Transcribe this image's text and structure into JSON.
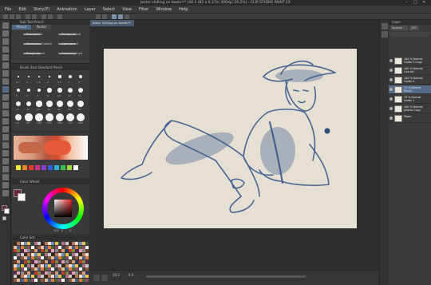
{
  "window": {
    "title": "Jester chilling on boots!!* (44.1 (85 x 6.27in 300dpi 29.2%) - CLIP STUDIO PAINT EX"
  },
  "menu": [
    "File",
    "Edit",
    "Story(P)",
    "Animation",
    "Layer",
    "Select",
    "View",
    "Filter",
    "Window",
    "Help"
  ],
  "subtool": {
    "panel_title": "Sub Tool Pencil",
    "tabs": [
      "Pencil",
      "Pastel"
    ],
    "brushes": [
      {
        "label": "Real pencil"
      },
      {
        "label": "Design pencil"
      },
      {
        "label": "Mechanical pencil"
      },
      {
        "label": "Light pencil"
      },
      {
        "label": "Rough pencil"
      },
      {
        "label": "Colored pencil"
      }
    ]
  },
  "brush_size": {
    "panel_title": "Brush Size Standard Pencil",
    "labels": [
      "0.7",
      "1",
      "1.5",
      "2",
      "2.5",
      "3",
      "4",
      "5",
      "6",
      "7",
      "8",
      "10",
      "12",
      "15",
      "17",
      "20",
      "25",
      "30",
      "40",
      "50",
      "60",
      "70",
      "80",
      "100",
      "120",
      "150",
      "170",
      "200"
    ]
  },
  "color_wheel": {
    "panel_title": "Color Wheel",
    "readout": [
      "255",
      "0",
      "0"
    ]
  },
  "color_set": {
    "panel_title": "Color Set"
  },
  "document_tab": "Jester chilling on boots!!*",
  "layers": {
    "panel_title": "Layer",
    "blend_mode": "Normal",
    "opacity": "100",
    "items": [
      {
        "name": "100 % Normal\nFolder 3 Copy",
        "selected": false
      },
      {
        "name": "100 % Normal\nLine art",
        "selected": false
      },
      {
        "name": "100 % Normal\nFolder 4",
        "selected": false
      },
      {
        "name": "74 % Normal\nPencil",
        "selected": true
      },
      {
        "name": "79 % Normal\nFolder 1",
        "selected": false
      },
      {
        "name": "100 % Normal\nphotos Copy",
        "selected": false
      },
      {
        "name": "Paper",
        "selected": false
      }
    ]
  },
  "status": {
    "zoom": "29.2",
    "angle": "0.0"
  },
  "colors": {
    "accent": "#566c8a",
    "paper": "#e6dfd3",
    "ink": "#3a5a8c",
    "main_color": "#6b2a3a",
    "sub_color": "#ffffff"
  }
}
